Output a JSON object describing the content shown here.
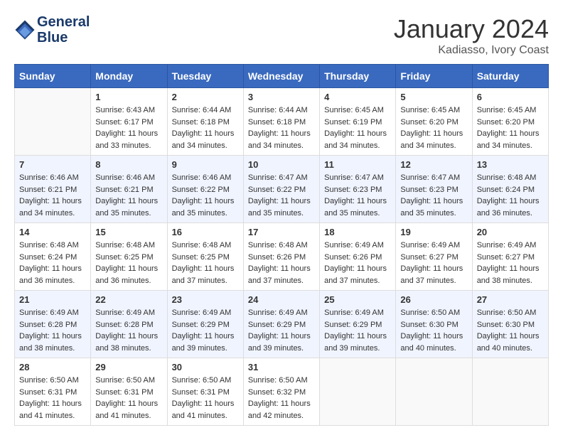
{
  "header": {
    "logo_line1": "General",
    "logo_line2": "Blue",
    "month": "January 2024",
    "location": "Kadiasso, Ivory Coast"
  },
  "weekdays": [
    "Sunday",
    "Monday",
    "Tuesday",
    "Wednesday",
    "Thursday",
    "Friday",
    "Saturday"
  ],
  "weeks": [
    [
      {
        "day": "",
        "sunrise": "",
        "sunset": "",
        "daylight": ""
      },
      {
        "day": "1",
        "sunrise": "Sunrise: 6:43 AM",
        "sunset": "Sunset: 6:17 PM",
        "daylight": "Daylight: 11 hours and 33 minutes."
      },
      {
        "day": "2",
        "sunrise": "Sunrise: 6:44 AM",
        "sunset": "Sunset: 6:18 PM",
        "daylight": "Daylight: 11 hours and 34 minutes."
      },
      {
        "day": "3",
        "sunrise": "Sunrise: 6:44 AM",
        "sunset": "Sunset: 6:18 PM",
        "daylight": "Daylight: 11 hours and 34 minutes."
      },
      {
        "day": "4",
        "sunrise": "Sunrise: 6:45 AM",
        "sunset": "Sunset: 6:19 PM",
        "daylight": "Daylight: 11 hours and 34 minutes."
      },
      {
        "day": "5",
        "sunrise": "Sunrise: 6:45 AM",
        "sunset": "Sunset: 6:20 PM",
        "daylight": "Daylight: 11 hours and 34 minutes."
      },
      {
        "day": "6",
        "sunrise": "Sunrise: 6:45 AM",
        "sunset": "Sunset: 6:20 PM",
        "daylight": "Daylight: 11 hours and 34 minutes."
      }
    ],
    [
      {
        "day": "7",
        "sunrise": "Sunrise: 6:46 AM",
        "sunset": "Sunset: 6:21 PM",
        "daylight": "Daylight: 11 hours and 34 minutes."
      },
      {
        "day": "8",
        "sunrise": "Sunrise: 6:46 AM",
        "sunset": "Sunset: 6:21 PM",
        "daylight": "Daylight: 11 hours and 35 minutes."
      },
      {
        "day": "9",
        "sunrise": "Sunrise: 6:46 AM",
        "sunset": "Sunset: 6:22 PM",
        "daylight": "Daylight: 11 hours and 35 minutes."
      },
      {
        "day": "10",
        "sunrise": "Sunrise: 6:47 AM",
        "sunset": "Sunset: 6:22 PM",
        "daylight": "Daylight: 11 hours and 35 minutes."
      },
      {
        "day": "11",
        "sunrise": "Sunrise: 6:47 AM",
        "sunset": "Sunset: 6:23 PM",
        "daylight": "Daylight: 11 hours and 35 minutes."
      },
      {
        "day": "12",
        "sunrise": "Sunrise: 6:47 AM",
        "sunset": "Sunset: 6:23 PM",
        "daylight": "Daylight: 11 hours and 35 minutes."
      },
      {
        "day": "13",
        "sunrise": "Sunrise: 6:48 AM",
        "sunset": "Sunset: 6:24 PM",
        "daylight": "Daylight: 11 hours and 36 minutes."
      }
    ],
    [
      {
        "day": "14",
        "sunrise": "Sunrise: 6:48 AM",
        "sunset": "Sunset: 6:24 PM",
        "daylight": "Daylight: 11 hours and 36 minutes."
      },
      {
        "day": "15",
        "sunrise": "Sunrise: 6:48 AM",
        "sunset": "Sunset: 6:25 PM",
        "daylight": "Daylight: 11 hours and 36 minutes."
      },
      {
        "day": "16",
        "sunrise": "Sunrise: 6:48 AM",
        "sunset": "Sunset: 6:25 PM",
        "daylight": "Daylight: 11 hours and 37 minutes."
      },
      {
        "day": "17",
        "sunrise": "Sunrise: 6:48 AM",
        "sunset": "Sunset: 6:26 PM",
        "daylight": "Daylight: 11 hours and 37 minutes."
      },
      {
        "day": "18",
        "sunrise": "Sunrise: 6:49 AM",
        "sunset": "Sunset: 6:26 PM",
        "daylight": "Daylight: 11 hours and 37 minutes."
      },
      {
        "day": "19",
        "sunrise": "Sunrise: 6:49 AM",
        "sunset": "Sunset: 6:27 PM",
        "daylight": "Daylight: 11 hours and 37 minutes."
      },
      {
        "day": "20",
        "sunrise": "Sunrise: 6:49 AM",
        "sunset": "Sunset: 6:27 PM",
        "daylight": "Daylight: 11 hours and 38 minutes."
      }
    ],
    [
      {
        "day": "21",
        "sunrise": "Sunrise: 6:49 AM",
        "sunset": "Sunset: 6:28 PM",
        "daylight": "Daylight: 11 hours and 38 minutes."
      },
      {
        "day": "22",
        "sunrise": "Sunrise: 6:49 AM",
        "sunset": "Sunset: 6:28 PM",
        "daylight": "Daylight: 11 hours and 38 minutes."
      },
      {
        "day": "23",
        "sunrise": "Sunrise: 6:49 AM",
        "sunset": "Sunset: 6:29 PM",
        "daylight": "Daylight: 11 hours and 39 minutes."
      },
      {
        "day": "24",
        "sunrise": "Sunrise: 6:49 AM",
        "sunset": "Sunset: 6:29 PM",
        "daylight": "Daylight: 11 hours and 39 minutes."
      },
      {
        "day": "25",
        "sunrise": "Sunrise: 6:49 AM",
        "sunset": "Sunset: 6:29 PM",
        "daylight": "Daylight: 11 hours and 39 minutes."
      },
      {
        "day": "26",
        "sunrise": "Sunrise: 6:50 AM",
        "sunset": "Sunset: 6:30 PM",
        "daylight": "Daylight: 11 hours and 40 minutes."
      },
      {
        "day": "27",
        "sunrise": "Sunrise: 6:50 AM",
        "sunset": "Sunset: 6:30 PM",
        "daylight": "Daylight: 11 hours and 40 minutes."
      }
    ],
    [
      {
        "day": "28",
        "sunrise": "Sunrise: 6:50 AM",
        "sunset": "Sunset: 6:31 PM",
        "daylight": "Daylight: 11 hours and 41 minutes."
      },
      {
        "day": "29",
        "sunrise": "Sunrise: 6:50 AM",
        "sunset": "Sunset: 6:31 PM",
        "daylight": "Daylight: 11 hours and 41 minutes."
      },
      {
        "day": "30",
        "sunrise": "Sunrise: 6:50 AM",
        "sunset": "Sunset: 6:31 PM",
        "daylight": "Daylight: 11 hours and 41 minutes."
      },
      {
        "day": "31",
        "sunrise": "Sunrise: 6:50 AM",
        "sunset": "Sunset: 6:32 PM",
        "daylight": "Daylight: 11 hours and 42 minutes."
      },
      {
        "day": "",
        "sunrise": "",
        "sunset": "",
        "daylight": ""
      },
      {
        "day": "",
        "sunrise": "",
        "sunset": "",
        "daylight": ""
      },
      {
        "day": "",
        "sunrise": "",
        "sunset": "",
        "daylight": ""
      }
    ]
  ]
}
